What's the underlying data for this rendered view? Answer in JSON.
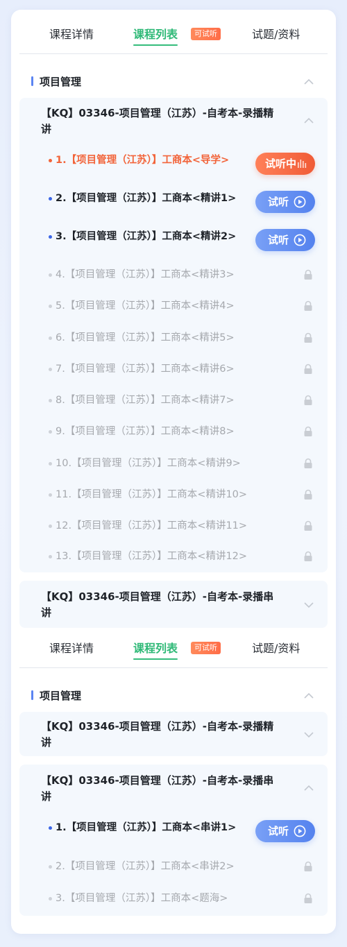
{
  "tabs": {
    "detail": "课程详情",
    "list": "课程列表",
    "trial_badge": "可试听",
    "materials": "试题/资料"
  },
  "block1": {
    "section": "项目管理",
    "course1": {
      "title": "【KQ】03346-项目管理（江苏）-自考本-录播精讲",
      "lessons": [
        {
          "label": "1.【项目管理（江苏）】工商本<导学>",
          "state": "current",
          "button": "试听中"
        },
        {
          "label": "2.【项目管理（江苏）】工商本<精讲1>",
          "state": "free",
          "button": "试听"
        },
        {
          "label": "3.【项目管理（江苏）】工商本<精讲2>",
          "state": "free",
          "button": "试听"
        },
        {
          "label": "4.【项目管理（江苏）】工商本<精讲3>",
          "state": "locked"
        },
        {
          "label": "5.【项目管理（江苏）】工商本<精讲4>",
          "state": "locked"
        },
        {
          "label": "6.【项目管理（江苏）】工商本<精讲5>",
          "state": "locked"
        },
        {
          "label": "7.【项目管理（江苏）】工商本<精讲6>",
          "state": "locked"
        },
        {
          "label": "8.【项目管理（江苏）】工商本<精讲7>",
          "state": "locked"
        },
        {
          "label": "9.【项目管理（江苏）】工商本<精讲8>",
          "state": "locked"
        },
        {
          "label": "10.【项目管理（江苏）】工商本<精讲9>",
          "state": "locked"
        },
        {
          "label": "11.【项目管理（江苏）】工商本<精讲10>",
          "state": "locked"
        },
        {
          "label": "12.【项目管理（江苏）】工商本<精讲11>",
          "state": "locked"
        },
        {
          "label": "13.【项目管理（江苏）】工商本<精讲12>",
          "state": "locked"
        }
      ]
    },
    "course2": {
      "title": "【KQ】03346-项目管理（江苏）-自考本-录播串讲"
    }
  },
  "block2": {
    "section": "项目管理",
    "course1": {
      "title": "【KQ】03346-项目管理（江苏）-自考本-录播精讲"
    },
    "course2": {
      "title": "【KQ】03346-项目管理（江苏）-自考本-录播串讲",
      "lessons": [
        {
          "label": "1.【项目管理（江苏）】工商本<串讲1>",
          "state": "free",
          "button": "试听"
        },
        {
          "label": "2.【项目管理（江苏）】工商本<串讲2>",
          "state": "locked"
        },
        {
          "label": "3.【项目管理（江苏）】工商本<题海>",
          "state": "locked"
        }
      ]
    }
  },
  "colors": {
    "accent_green": "#2fb977",
    "current_orange": "#f2643a",
    "trial_blue": "#5482ee",
    "locked_gray": "#a6a9ae"
  }
}
